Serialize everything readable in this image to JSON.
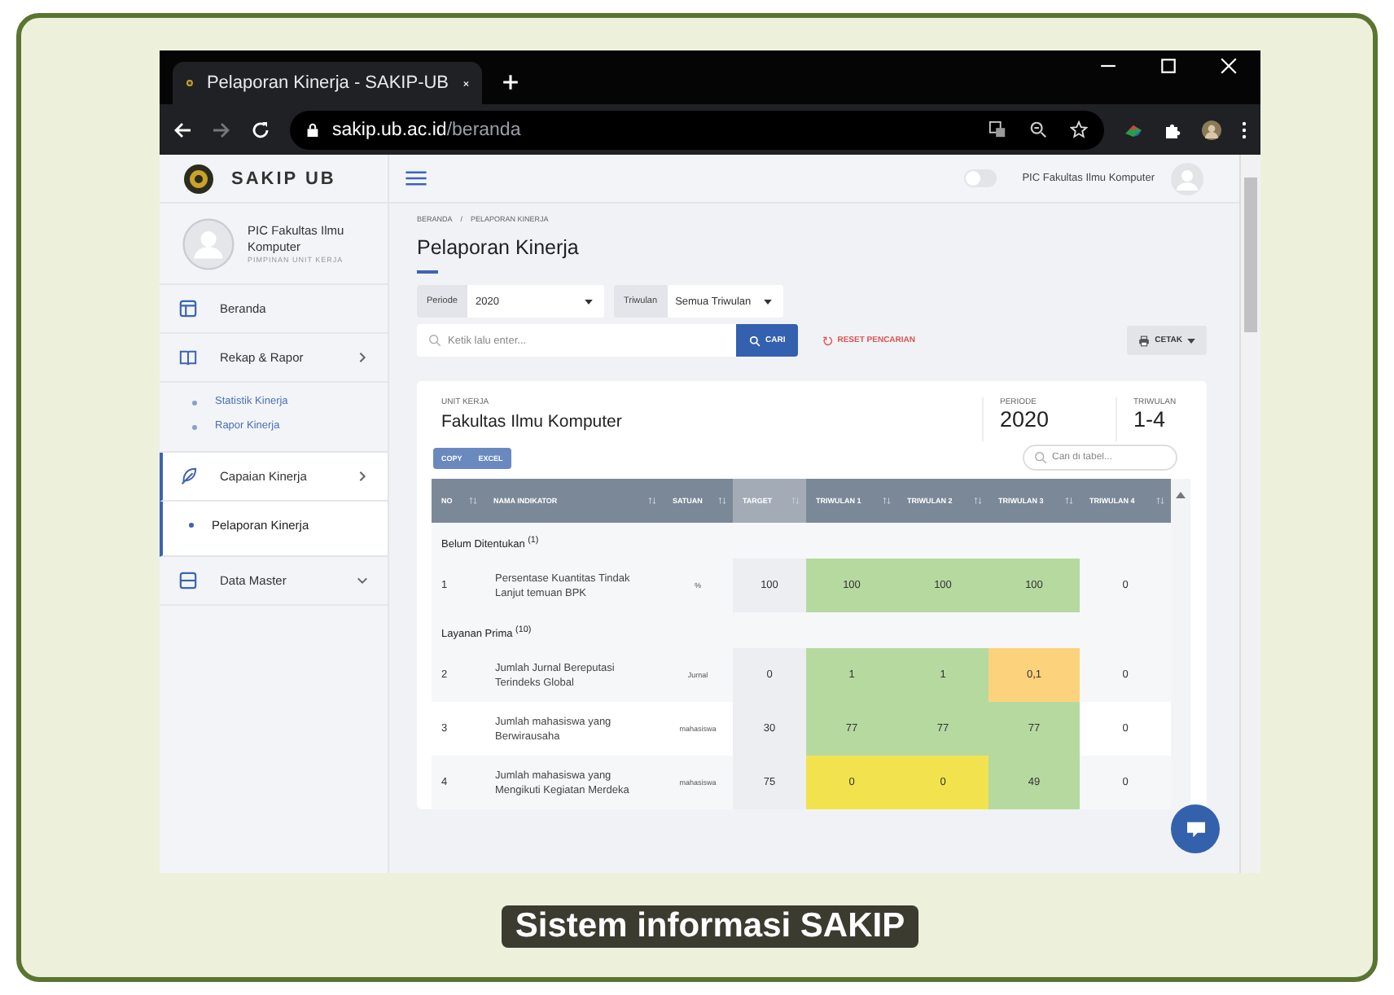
{
  "browser": {
    "tab_title": "Pelaporan Kinerja - SAKIP-UB",
    "url_host": "sakip.ub.ac.id",
    "url_path": "/beranda"
  },
  "sidebar": {
    "brand": "SAKIP UB",
    "profile": {
      "name": "PIC Fakultas Ilmu Komputer",
      "role": "PIMPINAN UNIT KERJA"
    },
    "items": [
      {
        "label": "Beranda",
        "selected": false
      },
      {
        "label": "Rekap & Rapor",
        "selected": false,
        "expanded": true,
        "children": [
          {
            "label": "Statistik Kinerja",
            "selected": false
          },
          {
            "label": "Rapor Kinerja",
            "selected": false
          }
        ]
      },
      {
        "label": "Capaian Kinerja",
        "selected": true,
        "expanded": true,
        "children": [
          {
            "label": "Pelaporan Kinerja",
            "selected": true
          }
        ]
      },
      {
        "label": "Data Master",
        "selected": false,
        "expanded": false
      }
    ]
  },
  "header": {
    "user": "PIC Fakultas Ilmu Komputer",
    "dark_mode": false
  },
  "page": {
    "breadcrumb": [
      "BERANDA",
      "PELAPORAN KINERJA"
    ],
    "breadcrumb_separator": "/",
    "title": "Pelaporan Kinerja",
    "filters": [
      {
        "label": "Periode",
        "value": "2020"
      },
      {
        "label": "Triwulan",
        "value": "Semua Triwulan"
      }
    ],
    "search": {
      "placeholder": "Ketik lalu enter...",
      "button": "CARI"
    },
    "reset": "RESET PENCARIAN",
    "print": "CETAK"
  },
  "report": {
    "summary": [
      {
        "label": "UNIT KERJA",
        "value": "Fakultas Ilmu Komputer"
      },
      {
        "label": "PERIODE",
        "value": "2020"
      },
      {
        "label": "TRIWULAN",
        "value": "1-4"
      }
    ],
    "export_buttons": [
      "COPY",
      "EXCEL"
    ],
    "table_search": {
      "placeholder": "Cari di tabel..."
    },
    "columns": [
      {
        "label": "NO",
        "sorted": false
      },
      {
        "label": "NAMA INDIKATOR",
        "sorted": false
      },
      {
        "label": "SATUAN",
        "sorted": false
      },
      {
        "label": "TARGET",
        "sorted": true
      },
      {
        "label": "TRIWULAN 1",
        "sorted": false
      },
      {
        "label": "TRIWULAN 2",
        "sorted": false
      },
      {
        "label": "TRIWULAN 3",
        "sorted": false
      },
      {
        "label": "TRIWULAN 4",
        "sorted": false
      }
    ],
    "rows": [
      {
        "kind": "group",
        "label": "Belum Ditentukan $^{(1)}$"
      },
      {
        "kind": "item",
        "no": "1",
        "name": "Persentase Kuantitas Tindak Lanjut temuan BPK",
        "unit": "%",
        "target": "100",
        "quarters": [
          {
            "value": "100",
            "color": "#b6d9a0"
          },
          {
            "value": "100",
            "color": "#b6d9a0"
          },
          {
            "value": "100",
            "color": "#b6d9a0"
          },
          {
            "value": "0"
          }
        ]
      },
      {
        "kind": "group",
        "label": "Layanan Prima $^{(10)}$"
      },
      {
        "kind": "item",
        "no": "2",
        "name": "Jumlah Jurnal Bereputasi Terindeks Global",
        "unit": "Jurnal",
        "target": "0",
        "quarters": [
          {
            "value": "1",
            "color": "#b6d9a0"
          },
          {
            "value": "1",
            "color": "#b6d9a0"
          },
          {
            "value": "0,1",
            "color": "#fdd27c"
          },
          {
            "value": "0"
          }
        ]
      },
      {
        "kind": "item",
        "no": "3",
        "name": "Jumlah mahasiswa yang Berwirausaha",
        "unit": "mahasiswa",
        "target": "30",
        "quarters": [
          {
            "value": "77",
            "color": "#b6d9a0"
          },
          {
            "value": "77",
            "color": "#b6d9a0"
          },
          {
            "value": "77",
            "color": "#b6d9a0"
          },
          {
            "value": "0"
          }
        ]
      },
      {
        "kind": "item",
        "no": "4",
        "name": "Jumlah mahasiswa yang Mengikuti Kegiatan Merdeka",
        "unit": "mahasiswa",
        "target": "75",
        "quarters": [
          {
            "value": "0",
            "color": "#f2e34e"
          },
          {
            "value": "0",
            "color": "#f2e34e"
          },
          {
            "value": "49",
            "color": "#b6d9a0"
          },
          {
            "value": "0"
          }
        ]
      }
    ]
  },
  "caption": "Sistem informasi SAKIP"
}
